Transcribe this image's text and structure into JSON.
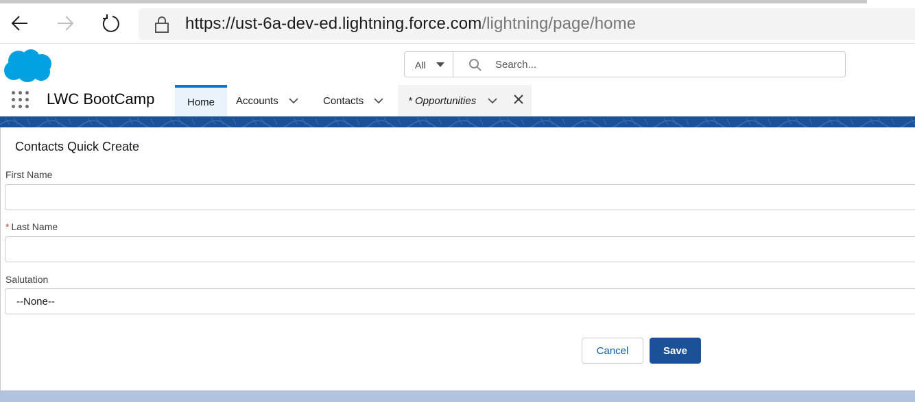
{
  "browser": {
    "url_host": "https://ust-6a-dev-ed.lightning.force.com",
    "url_path": "/lightning/page/home"
  },
  "header": {
    "search": {
      "scope": "All",
      "placeholder": "Search..."
    },
    "app_name": "LWC BootCamp",
    "tabs": [
      {
        "label": "Home"
      },
      {
        "label": "Accounts"
      },
      {
        "label": "Contacts"
      },
      {
        "label": "* Opportunities"
      }
    ]
  },
  "form": {
    "title": "Contacts Quick Create",
    "first_name_label": "First Name",
    "last_name_required_mark": "*",
    "last_name_label": "Last Name",
    "salutation_label": "Salutation",
    "salutation_value": "--None--",
    "cancel_label": "Cancel",
    "save_label": "Save"
  },
  "colors": {
    "brand_blue": "#1b5297",
    "active_tab_accent": "#0176d3",
    "required_red": "#c23934"
  }
}
